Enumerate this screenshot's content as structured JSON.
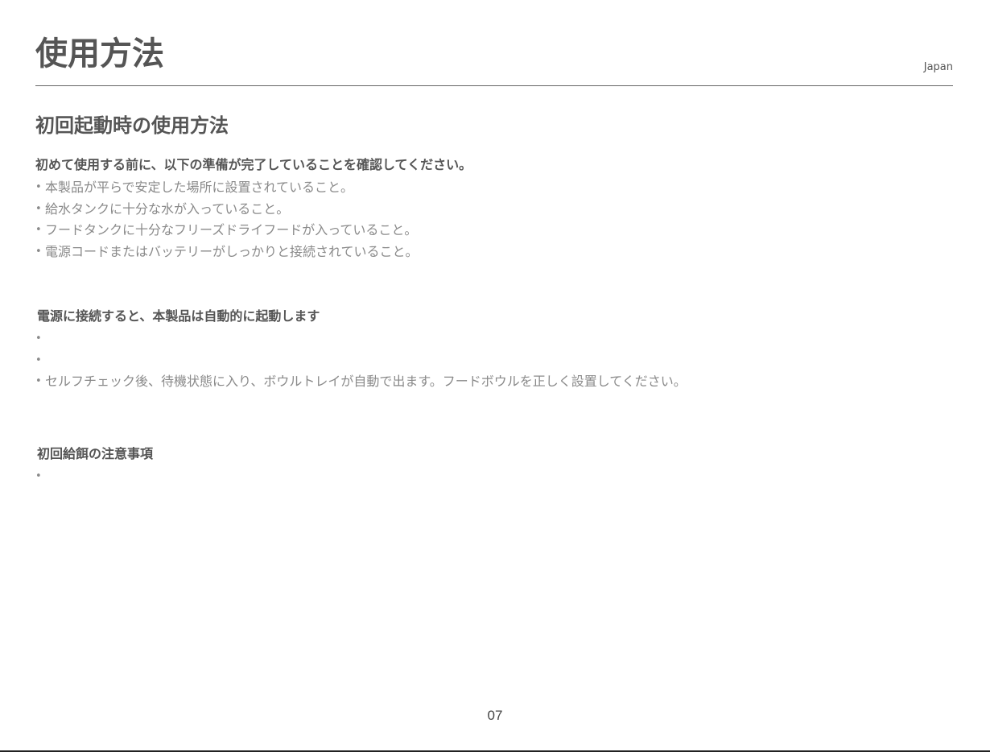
{
  "header": {
    "title": "使用方法",
    "region": "Japan"
  },
  "section": {
    "title": "初回起動時の使用方法"
  },
  "preparation": {
    "heading": "初めて使用する前に、以下の準備が完了していることを確認してください。",
    "items": [
      "本製品が平らで安定した場所に設置されていること。",
      "給水タンクに十分な水が入っていること。",
      "フードタンクに十分なフリーズドライフードが入っていること。",
      "電源コードまたはバッテリーがしっかりと接続されていること。"
    ]
  },
  "startup": {
    "heading": "電源に接続すると、本製品は自動的に起動します",
    "items": [
      "",
      "",
      "セルフチェック後、待機状態に入り、ボウルトレイが自動で出ます。フードボウルを正しく設置してください。"
    ]
  },
  "first_feeding": {
    "heading": "初回給餌の注意事項",
    "items": [
      ""
    ]
  },
  "footer": {
    "page_number": "07"
  }
}
